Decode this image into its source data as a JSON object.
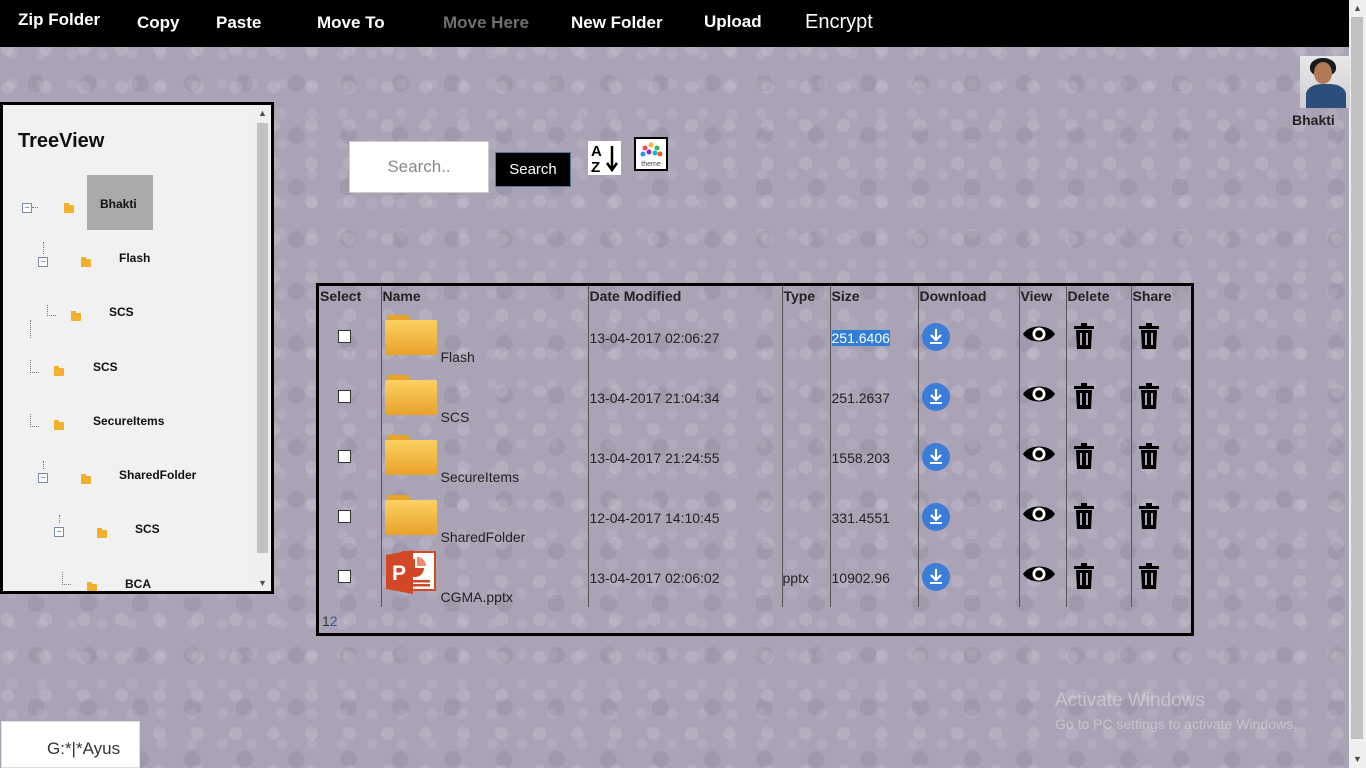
{
  "toolbar": {
    "zip_folder": "Zip Folder",
    "copy": "Copy",
    "paste": "Paste",
    "move_to": "Move To",
    "move_here": "Move Here",
    "new_folder": "New Folder",
    "upload": "Upload",
    "encrypt": "Encrypt"
  },
  "user": {
    "name": "Bhakti"
  },
  "tree": {
    "title": "TreeView",
    "nodes": [
      "Bhakti",
      "Flash",
      "SCS",
      "SCS",
      "SecureItems",
      "SharedFolder",
      "SCS",
      "BCA"
    ]
  },
  "search": {
    "placeholder": "Search..",
    "button": "Search"
  },
  "icons": {
    "sort": "sort-alpha-down-icon",
    "theme": "theme-palette-icon",
    "theme_caption": "theme",
    "download": "download-icon",
    "view": "eye-icon",
    "delete": "trash-icon",
    "share": "trash-icon",
    "ppt": "powerpoint-icon",
    "folder": "folder-icon"
  },
  "table": {
    "headers": [
      "Select",
      "Name",
      "Date Modified",
      "Type",
      "Size",
      "Download",
      "View",
      "Delete",
      "Share"
    ],
    "rows": [
      {
        "name": "Flash",
        "kind": "folder",
        "date": "13-04-2017 02:06:27",
        "type": "",
        "size": "251.6406",
        "selected_text": true
      },
      {
        "name": "SCS",
        "kind": "folder",
        "date": "13-04-2017 21:04:34",
        "type": "",
        "size": "251.2637"
      },
      {
        "name": "SecureItems",
        "kind": "folder",
        "date": "13-04-2017 21:24:55",
        "type": "",
        "size": "1558.203"
      },
      {
        "name": "SharedFolder",
        "kind": "folder",
        "date": "12-04-2017 14:10:45",
        "type": "",
        "size": "331.4551"
      },
      {
        "name": "CGMA.pptx",
        "kind": "ppt",
        "date": "13-04-2017 02:06:02",
        "type": "pptx",
        "size": "10902.96"
      }
    ],
    "pages": [
      "1",
      "2"
    ]
  },
  "path_box": {
    "value": "G:*|*Ayus"
  },
  "watermark": {
    "line1": "Activate Windows",
    "line2": "Go to PC settings to activate Windows."
  },
  "colors": {
    "download_blue": "#3b7dd8",
    "folder_yellow": "#f1b12c",
    "ppt_red": "#d24726",
    "selection": "#2f7fd8"
  }
}
